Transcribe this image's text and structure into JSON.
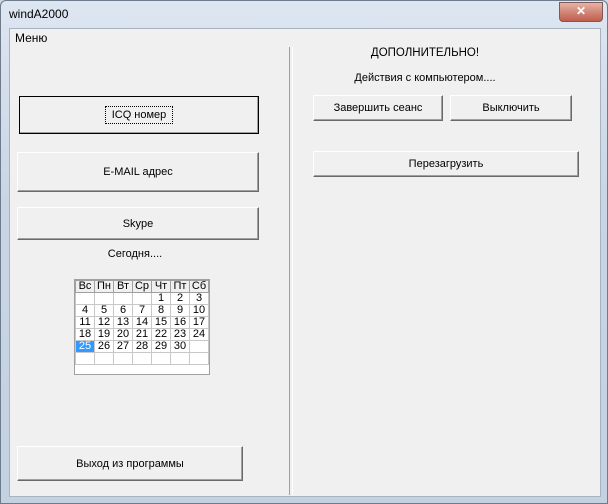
{
  "window": {
    "title": "windA2000",
    "close_glyph": "✕"
  },
  "menu": {
    "label": "Меню"
  },
  "left": {
    "icq_button": "ICQ номер",
    "email_button": "E-MAIL адрес",
    "skype_button": "Skype",
    "today_label": "Сегодня....",
    "exit_button": "Выход из программы"
  },
  "right": {
    "heading": "ДОПОЛНИТЕЛЬНО!",
    "subheading": "Действия с компьютером....",
    "logoff_button": "Завершить сеанс",
    "shutdown_button": "Выключить",
    "restart_button": "Перезагрузить"
  },
  "calendar": {
    "weekdays": [
      "Вс",
      "Пн",
      "Вт",
      "Ср",
      "Чт",
      "Пт",
      "Сб"
    ],
    "weeks": [
      [
        "",
        "",
        "",
        "",
        "1",
        "2",
        "3"
      ],
      [
        "4",
        "5",
        "6",
        "7",
        "8",
        "9",
        "10"
      ],
      [
        "11",
        "12",
        "13",
        "14",
        "15",
        "16",
        "17"
      ],
      [
        "18",
        "19",
        "20",
        "21",
        "22",
        "23",
        "24"
      ],
      [
        "25",
        "26",
        "27",
        "28",
        "29",
        "30",
        ""
      ],
      [
        "",
        "",
        "",
        "",
        "",
        "",
        ""
      ]
    ],
    "selected_day": "25"
  },
  "colors": {
    "selected": "#3399ff",
    "close_button": "#c15d4d"
  }
}
